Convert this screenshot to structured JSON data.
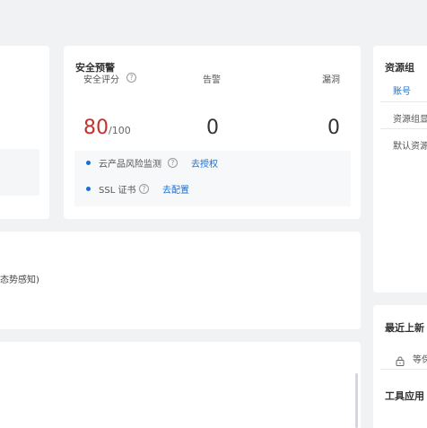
{
  "security": {
    "title": "安全预警",
    "score_label": "安全评分",
    "score_value": "80",
    "score_total": "/100",
    "alarm_label": "告警",
    "alarm_value": "0",
    "vuln_label": "漏洞",
    "vuln_value": "0",
    "risk_label": "云产品风险监测",
    "risk_action": "去授权",
    "ssl_label": "SSL 证书",
    "ssl_action": "去配置"
  },
  "resource": {
    "title": "资源组",
    "account": "账号",
    "group": "资源组显",
    "default_group": "默认资源"
  },
  "middle": {
    "text": "态势感知)"
  },
  "recent": {
    "title": "最近上新",
    "item": "等保"
  },
  "tools": {
    "title": "工具应用"
  },
  "colors": {
    "score": "#c9302c",
    "link": "#1a6fd0",
    "background": "#f1f2f4"
  }
}
